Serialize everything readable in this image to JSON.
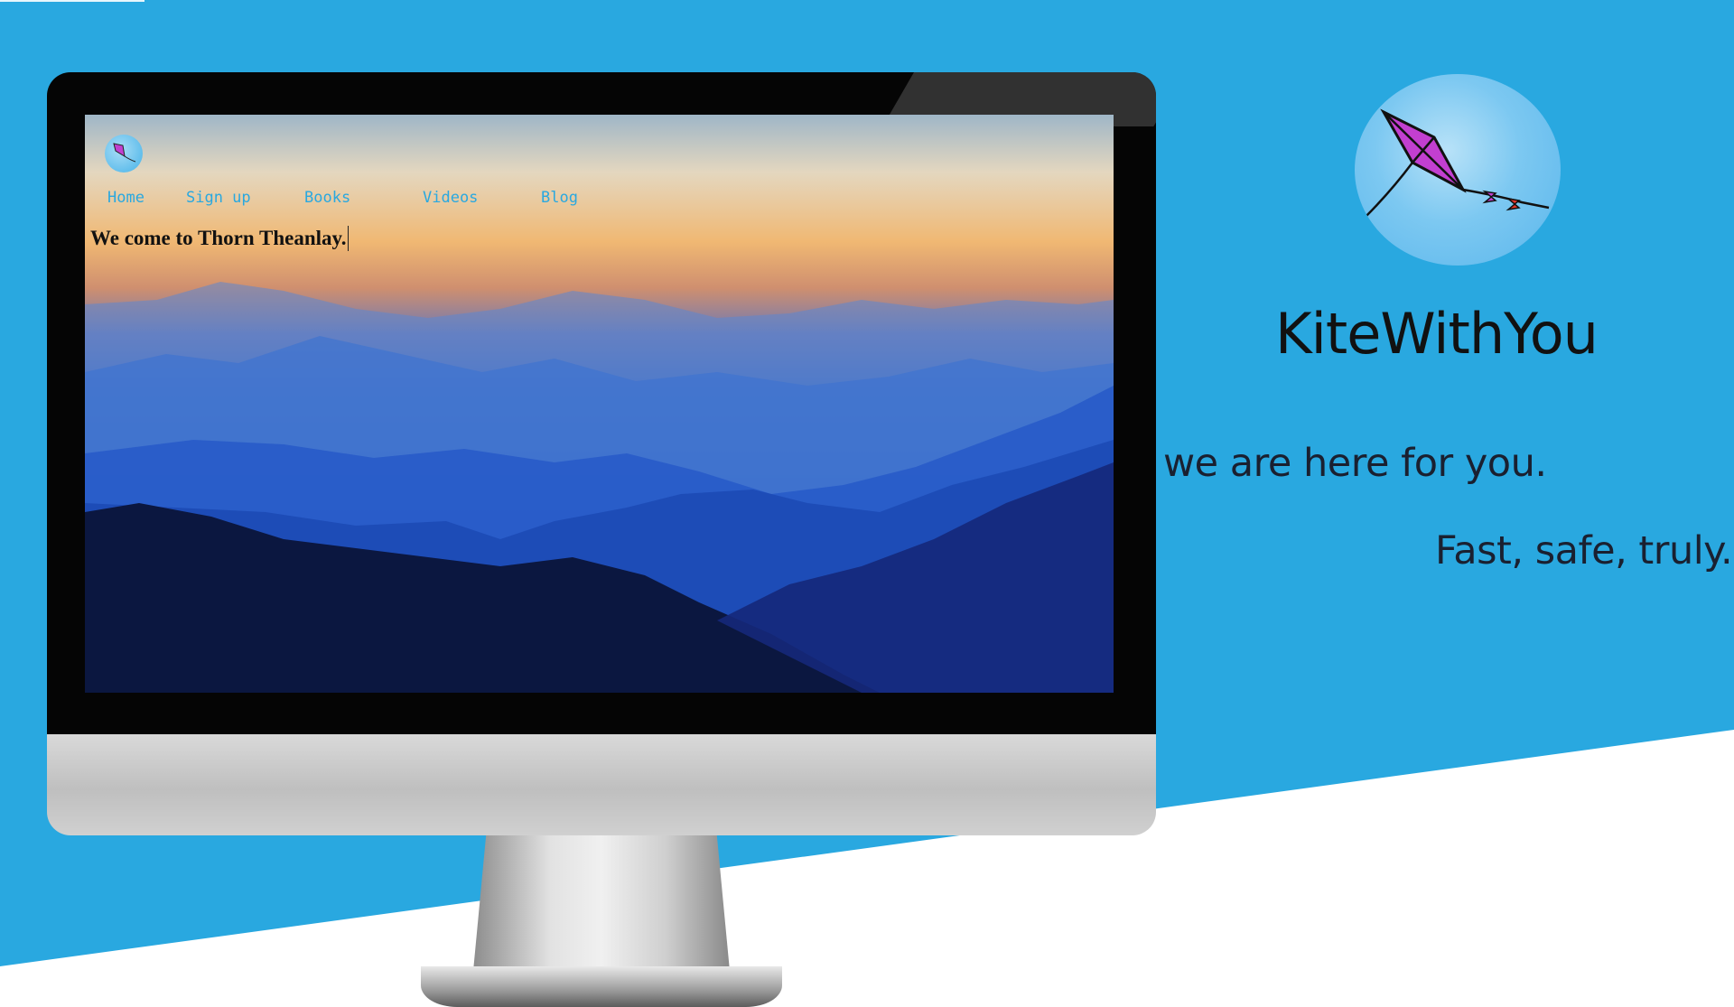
{
  "site": {
    "nav": [
      {
        "label": "Home"
      },
      {
        "label": "Sign up"
      },
      {
        "label": "Books"
      },
      {
        "label": "Videos"
      },
      {
        "label": "Blog"
      }
    ],
    "welcome_text": "We come to Thorn Theanlay."
  },
  "brand": {
    "name": "KiteWithYou",
    "tagline": "we are here for you.",
    "slogan": "Fast, safe, truly.",
    "logo_icon": "kite-icon"
  },
  "colors": {
    "background_blue": "#29a8e0",
    "nav_link": "#29a8e0",
    "kite_fill": "#c23fd0"
  }
}
